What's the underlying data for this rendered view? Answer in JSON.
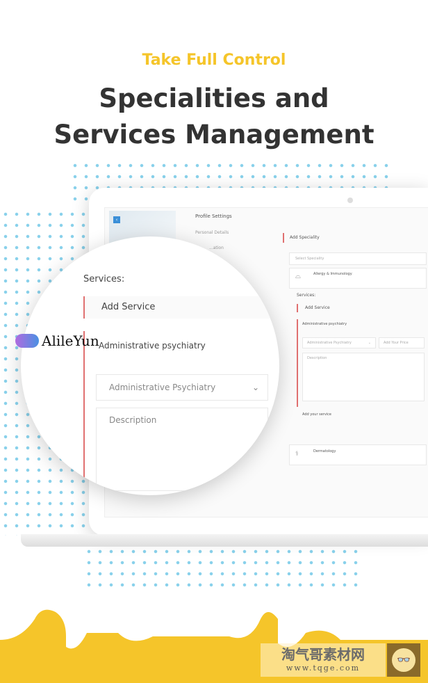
{
  "header": {
    "kicker": "Take Full Control",
    "title_line1": "Specialities and",
    "title_line2": "Services Management"
  },
  "screen": {
    "profile_settings": "Profile Settings",
    "personal_details": "Personal Details",
    "tab_partial": "...ation",
    "add_speciality": "Add Speciality",
    "select_speciality_placeholder": "Select Speciality",
    "speciality_1": "Allergy & Immunology",
    "services_label": "Services:",
    "add_service": "Add Service",
    "service_title": "Administrative psychiatry",
    "service_select": "Administrative Psychiatry",
    "price_placeholder": "Add Your Price",
    "description_placeholder": "Description",
    "add_your_service": "Add your service",
    "speciality_2": "Dermatology"
  },
  "lens": {
    "services_label": "Services:",
    "add_service": "Add Service",
    "service_title": "Administrative psychiatry",
    "service_select": "Administrative Psychiatry",
    "description_placeholder": "Description"
  },
  "watermarks": {
    "brand": "AlileYun",
    "site_cn": "淘气哥素材网",
    "site_url": "www.tqge.com"
  },
  "colors": {
    "accent": "#f5c52a",
    "title": "#333333",
    "red_bar": "#e07070",
    "dots": "#6cc6e6"
  }
}
